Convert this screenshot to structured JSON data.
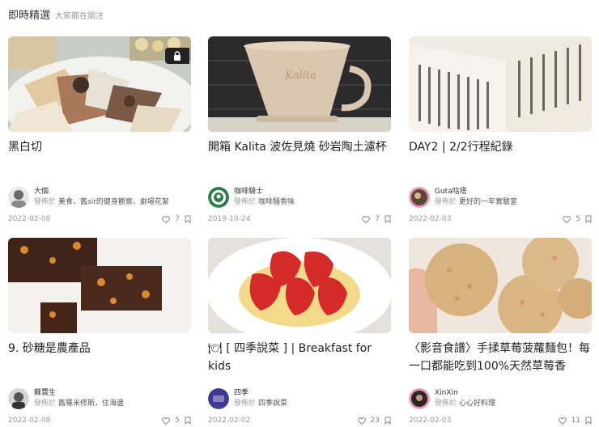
{
  "header": {
    "title": "即時精選",
    "subtitle": "大家都在關注"
  },
  "cards": [
    {
      "title": "黑白切",
      "author": "大個",
      "pub_prefix": "發佈於",
      "pub_target": "美食、舊sir的健身觀察、劇場花絮",
      "date": "2022-02-08",
      "likes": "7",
      "locked": true
    },
    {
      "title": "開箱 Kalita 波佐見燒 砂岩陶土濾杯",
      "author": "咖啡騎士",
      "pub_prefix": "發佈於",
      "pub_target": "咖啡騷香味",
      "date": "2019-10-24",
      "likes": "7",
      "locked": false
    },
    {
      "title": "DAY2 | 2/2行程紀錄",
      "author": "Guta咕塔",
      "pub_prefix": "發佈於",
      "pub_target": "更好的一年實驗室",
      "date": "2022-02-03",
      "likes": "5",
      "locked": false
    },
    {
      "title": "9. 砂糖是農產品",
      "author": "蘇賈生",
      "pub_prefix": "發佈於",
      "pub_target": "舊羅米修斯，住海邊",
      "date": "2022-02-08",
      "likes": "5",
      "locked": false
    },
    {
      "title": "🍽 [ 四季說菜 ] | Breakfast for kids",
      "author": "四季",
      "pub_prefix": "發佈於",
      "pub_target": "四季說菜",
      "date": "2022-02-02",
      "likes": "23",
      "locked": false
    },
    {
      "title": "〈影音食譜〉手揉草莓菠蘿麵包！每一口都能吃到100%天然草莓香",
      "author": "XinXin",
      "pub_prefix": "發佈於",
      "pub_target": "心心好料理",
      "date": "2022-02-03",
      "likes": "11",
      "locked": false
    }
  ]
}
